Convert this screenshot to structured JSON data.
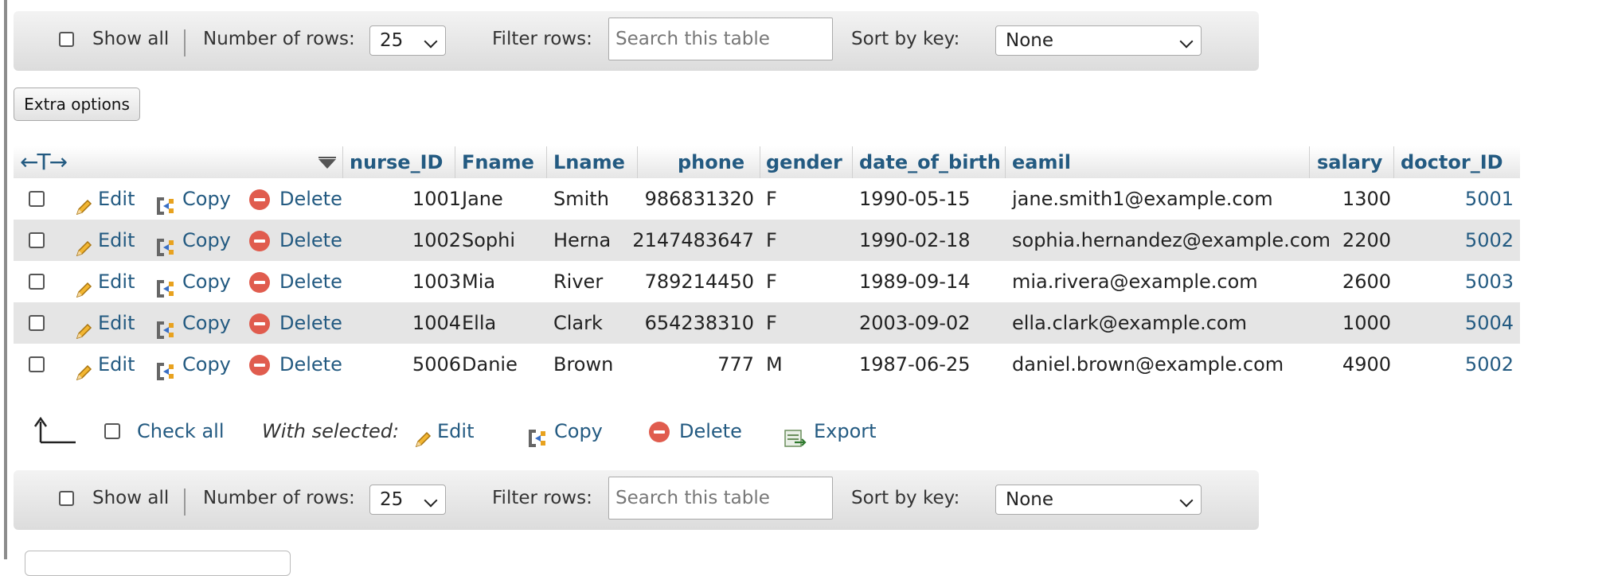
{
  "navbar": {
    "show_all_label": "Show all",
    "number_of_rows_label": "Number of rows:",
    "rows_value": "25",
    "filter_label": "Filter rows:",
    "search_placeholder": "Search this table",
    "sort_label": "Sort by key:",
    "sort_value": "None"
  },
  "extra_options_label": "Extra options",
  "table": {
    "columns": [
      "nurse_ID",
      "Fname",
      "Lname",
      "phone",
      "gender",
      "date_of_birth",
      "eamil",
      "salary",
      "doctor_ID"
    ],
    "row_actions": {
      "edit": "Edit",
      "copy": "Copy",
      "delete": "Delete"
    },
    "rows": [
      {
        "nurse_id": "1001",
        "fname": "Jane",
        "lname": "Smith",
        "phone": "986831320",
        "gender": "F",
        "dob": "1990-05-15",
        "email": "jane.smith1@example.com",
        "salary": "1300",
        "doctor_id": "5001"
      },
      {
        "nurse_id": "1002",
        "fname": "Sophi",
        "lname": "Herna",
        "phone": "2147483647",
        "gender": "F",
        "dob": "1990-02-18",
        "email": "sophia.hernandez@example.com",
        "salary": "2200",
        "doctor_id": "5002"
      },
      {
        "nurse_id": "1003",
        "fname": "Mia",
        "lname": "River",
        "phone": "789214450",
        "gender": "F",
        "dob": "1989-09-14",
        "email": "mia.rivera@example.com",
        "salary": "2600",
        "doctor_id": "5003"
      },
      {
        "nurse_id": "1004",
        "fname": "Ella",
        "lname": "Clark",
        "phone": "654238310",
        "gender": "F",
        "dob": "2003-09-02",
        "email": "ella.clark@example.com",
        "salary": "1000",
        "doctor_id": "5004"
      },
      {
        "nurse_id": "5006",
        "fname": "Danie",
        "lname": "Brown",
        "phone": "777",
        "gender": "M",
        "dob": "1987-06-25",
        "email": "daniel.brown@example.com",
        "salary": "4900",
        "doctor_id": "5002"
      }
    ]
  },
  "bulk": {
    "check_all": "Check all",
    "with_selected": "With selected:",
    "edit": "Edit",
    "copy": "Copy",
    "delete": "Delete",
    "export": "Export"
  },
  "colors": {
    "link": "#235a81",
    "delete_icon": "#e05c4e",
    "row_alt": "#e5e5e5"
  }
}
